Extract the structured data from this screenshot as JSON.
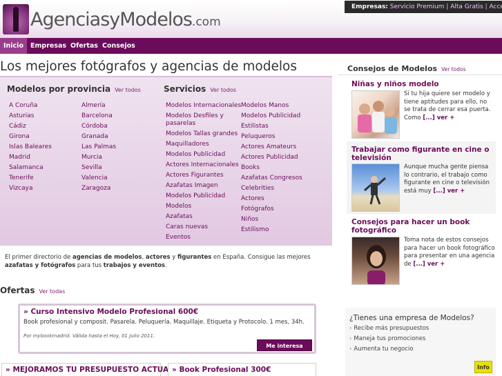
{
  "header": {
    "logo_main": "AgenciasyModelos",
    "logo_suffix": ".com",
    "empresas_label": "Empresas:",
    "empresas_links": [
      "Servicio Premium",
      "Alta Gratis",
      "Acceso"
    ],
    "separator": "|"
  },
  "nav": {
    "items": [
      "Inicio",
      "Empresas",
      "Ofertas",
      "Consejos"
    ],
    "active": "Inicio"
  },
  "main": {
    "title": "Los mejores fotógrafos y agencias de modelos",
    "provincias": {
      "title": "Modelos por provincia",
      "ver_todos": "Ver todos",
      "col1": [
        "A Coruña",
        "Asturias",
        "Cádiz",
        "Girona",
        "Islas Baleares",
        "Madrid",
        "Salamanca",
        "Tenerife",
        "Vizcaya"
      ],
      "col2": [
        "Almería",
        "Barcelona",
        "Córdoba",
        "Granada",
        "Las Palmas",
        "Murcia",
        "Sevilla",
        "Valencia",
        "Zaragoza"
      ]
    },
    "servicios": {
      "title": "Servicios",
      "ver_todos": "Ver todos",
      "col1": [
        "Modelos Internacionales",
        "Modelos Desfiles y pasarelas",
        "Modelos Tallas grandes",
        "Maquilladores",
        "Modelos Publicidad",
        "Actores Internacionales",
        "Actores Figurantes",
        "Azafatas Imagen",
        "Modelos Publicidad",
        "Modelos",
        "Azafatas",
        "Caras nuevas",
        "Eventos"
      ],
      "col2": [
        "Modelos Manos",
        "Modelos Publicidad",
        "Estilistas",
        "Peluqueros",
        "Actores Amateurs",
        "Actores Publicidad",
        "Books",
        "Azafatas Congresos",
        "Celebrities",
        "Actores",
        "Fotógrafos",
        "Niños",
        "Estilismo"
      ]
    },
    "intro": {
      "p1": "El primer directorio de ",
      "b1": "agencias de modelos",
      "p2": ", ",
      "b2": "actores",
      "p3": " y ",
      "b3": "figurantes",
      "p4": " en España. Consigue las mejores ",
      "b4": "azafatas y fotógrafos",
      "p5": " para tus ",
      "b5": "trabajos y eventos",
      "p6": "."
    },
    "ofertas": {
      "title": "Ofertas",
      "ver_todas": "Ver todas",
      "featured": {
        "title": "» Curso Intensivo Modelo Profesional 600€",
        "desc": "Book profesional y composit.  Pasarela.  Peluquería.  Maquillaje.  Etiqueta y Protocolo. 1 mes, 34h.",
        "meta": "Por mybookmadrid. Válida hasta el Hoy, 01 Julio 2011.",
        "button": "Me interesa"
      },
      "cards": [
        "» MEJORAMOS TU PRESUPUESTO ACTUAL",
        "» Book Profesional 300€"
      ]
    }
  },
  "sidebar": {
    "title": "Consejos de Modelos",
    "ver_todos": "Ver todos",
    "articles": [
      {
        "title": "Niñas y niños modelo",
        "excerpt": "Si tu hija quiere ser modelo y tiene aptitudes para ello, no se trata de cerrar esa puerta. Como ",
        "more": "[...] ver +"
      },
      {
        "title": "Trabajar como figurante en cine o televisión",
        "excerpt": "Aunque mucha gente piensa lo contrario, el trabajo como figurante en cine o televisión está muy ",
        "more": "[...] ver +"
      },
      {
        "title": "Consejos para hacer un book fotográfico",
        "excerpt": "Toma nota de estos consejos para hacer un book fotográfico para presentar en una agencia de ",
        "more": "[...] ver +"
      }
    ],
    "tienes": {
      "title": "¿Tienes una empresa de Modelos?",
      "items": [
        "Recibe más presupuestos",
        "Maneja tus promociones",
        "Aumenta tu negocio"
      ],
      "button": "Info"
    }
  },
  "colors": {
    "brand": "#6b0c5a",
    "nav_active": "#9a3e8c",
    "panel": "#e2c9e2",
    "info_button": "#e8e000"
  }
}
